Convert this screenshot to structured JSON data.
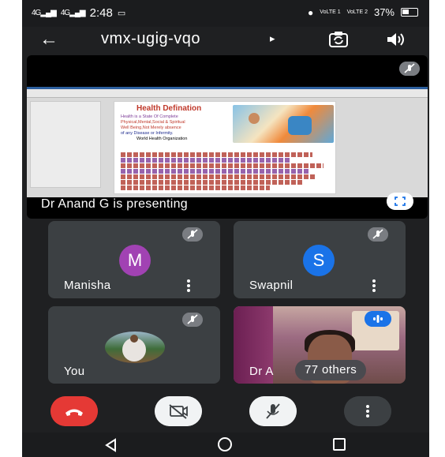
{
  "status_bar": {
    "signal_1": "4G",
    "signal_2": "4G",
    "time": "2:48",
    "network_1": "VoLTE 1",
    "network_2": "VoLTE 2",
    "battery": "37%"
  },
  "top_bar": {
    "meeting_code": "vmx-ugig-vqo",
    "dropdown_arrow": "▸"
  },
  "presentation": {
    "presenter_text": "Dr Anand G is presenting",
    "slide_title": "Health Defination",
    "slide_lines": [
      "Health is a State Of Complete",
      "Physical,Mental,Social & Spiritual",
      "Well Being,Not Merely absence",
      "of any Disease or Infermity.",
      "World Health Organization"
    ]
  },
  "participants": [
    {
      "name": "Manisha",
      "initial": "M",
      "avatar_color": "#a142b3"
    },
    {
      "name": "Swapnil",
      "initial": "S",
      "avatar_color": "#1a73e8"
    },
    {
      "name": "You"
    },
    {
      "name": "Dr A",
      "others_label": "77 others"
    }
  ],
  "colors": {
    "end_call": "#e53935",
    "tile_bg": "#3c4043",
    "app_bg": "#1f2022"
  },
  "icons": [
    "back-arrow-icon",
    "flip-camera-icon",
    "speaker-icon",
    "mic-off-icon",
    "fullscreen-icon",
    "more-vert-icon",
    "end-call-icon",
    "camera-off-icon",
    "audio-indicator-icon",
    "nav-back-icon",
    "nav-home-icon",
    "nav-recents-icon"
  ]
}
